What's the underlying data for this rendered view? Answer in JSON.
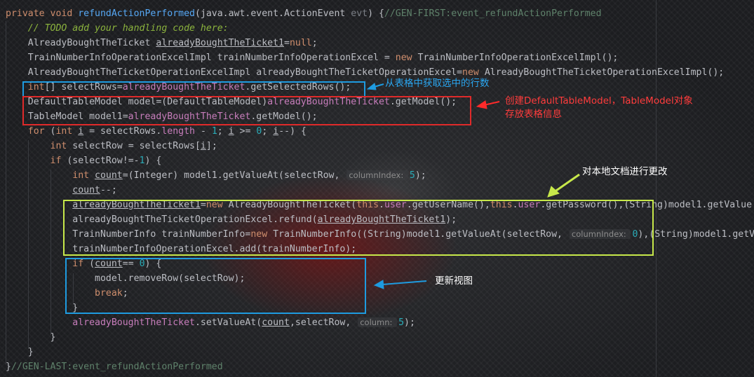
{
  "code_lines": [
    [
      {
        "t": "private void ",
        "c": "kw"
      },
      {
        "t": "refundActionPerformed",
        "c": "fn"
      },
      {
        "t": "(java.awt.event.ActionEvent "
      },
      {
        "t": "evt",
        "c": "cmt"
      },
      {
        "t": ") {"
      },
      {
        "t": "//GEN-FIRST:event_refundActionPerformed",
        "c": "gen"
      }
    ],
    [
      {
        "t": "    "
      },
      {
        "t": "// TODO add your handling code here:",
        "c": "cmt-todo"
      }
    ],
    [
      {
        "t": "    AlreadyBoughtTheTicket "
      },
      {
        "t": "alreadyBoughtTheTicket1",
        "c": "var-u"
      },
      {
        "t": "="
      },
      {
        "t": "null",
        "c": "kw"
      },
      {
        "t": ";"
      }
    ],
    [
      {
        "t": "    TrainNumberInfoOperationExcelImpl trainNumberInfoOperationExcel = "
      },
      {
        "t": "new ",
        "c": "kw"
      },
      {
        "t": "TrainNumberInfoOperationExcelImpl();"
      }
    ],
    [
      {
        "t": "    AlreadyBoughtTheTicketOperationExcelImpl alreadyBoughtTheTicketOperationExcel="
      },
      {
        "t": "new ",
        "c": "kw"
      },
      {
        "t": "AlreadyBoughtTheTicketOperationExcelImpl();"
      }
    ],
    [
      {
        "t": "    "
      },
      {
        "t": "int",
        "c": "kw"
      },
      {
        "t": "[] selectRows="
      },
      {
        "t": "alreadyBoughtTheTicket",
        "c": "fld"
      },
      {
        "t": ".getSelectedRows();"
      }
    ],
    [
      {
        "t": "    DefaultTableModel model=(DefaultTableModel)"
      },
      {
        "t": "alreadyBoughtTheTicket",
        "c": "fld"
      },
      {
        "t": ".getModel();"
      }
    ],
    [
      {
        "t": "    TableModel model1="
      },
      {
        "t": "alreadyBoughtTheTicket",
        "c": "fld"
      },
      {
        "t": ".getModel();"
      }
    ],
    [
      {
        "t": "    "
      },
      {
        "t": "for ",
        "c": "kw"
      },
      {
        "t": "("
      },
      {
        "t": "int ",
        "c": "kw"
      },
      {
        "t": "i",
        "c": "var-u"
      },
      {
        "t": " = selectRows."
      },
      {
        "t": "length",
        "c": "fld"
      },
      {
        "t": " - "
      },
      {
        "t": "1",
        "c": "num"
      },
      {
        "t": "; "
      },
      {
        "t": "i",
        "c": "var-u"
      },
      {
        "t": " >= "
      },
      {
        "t": "0",
        "c": "num"
      },
      {
        "t": "; "
      },
      {
        "t": "i",
        "c": "var-u"
      },
      {
        "t": "--) {"
      }
    ],
    [
      {
        "t": "        "
      },
      {
        "t": "int ",
        "c": "kw"
      },
      {
        "t": "selectRow = selectRows["
      },
      {
        "t": "i",
        "c": "var-u"
      },
      {
        "t": "];"
      }
    ],
    [
      {
        "t": "        "
      },
      {
        "t": "if ",
        "c": "kw"
      },
      {
        "t": "(selectRow!=-"
      },
      {
        "t": "1",
        "c": "num"
      },
      {
        "t": ") {"
      }
    ],
    [
      {
        "t": "            "
      },
      {
        "t": "int ",
        "c": "kw"
      },
      {
        "t": "count",
        "c": "var-u"
      },
      {
        "t": "=(Integer) model1.getValueAt(selectRow, "
      },
      {
        "t": "columnIndex: ",
        "c": "hint"
      },
      {
        "t": "5",
        "c": "num"
      },
      {
        "t": ");"
      }
    ],
    [
      {
        "t": "            "
      },
      {
        "t": "count",
        "c": "var-u"
      },
      {
        "t": "--;"
      }
    ],
    [
      {
        "t": "            "
      },
      {
        "t": "alreadyBoughtTheTicket1",
        "c": "var-u"
      },
      {
        "t": "="
      },
      {
        "t": "new ",
        "c": "kw"
      },
      {
        "t": "AlreadyBoughtTheTicket("
      },
      {
        "t": "this",
        "c": "kw"
      },
      {
        "t": "."
      },
      {
        "t": "user",
        "c": "fld"
      },
      {
        "t": ".getUserName(),"
      },
      {
        "t": "this",
        "c": "kw"
      },
      {
        "t": "."
      },
      {
        "t": "user",
        "c": "fld"
      },
      {
        "t": ".getPassword(),(String)model1.getValue"
      }
    ],
    [
      {
        "t": "            alreadyBoughtTheTicketOperationExcel.refund("
      },
      {
        "t": "alreadyBoughtTheTicket1",
        "c": "var-u"
      },
      {
        "t": ");"
      }
    ],
    [
      {
        "t": "            TrainNumberInfo trainNumberInfo="
      },
      {
        "t": "new ",
        "c": "kw"
      },
      {
        "t": "TrainNumberInfo((String)model1.getValueAt(selectRow, "
      },
      {
        "t": "columnIndex: ",
        "c": "hint"
      },
      {
        "t": "0",
        "c": "num"
      },
      {
        "t": "),(String)model1.getV"
      }
    ],
    [
      {
        "t": "            trainNumberInfoOperationExcel.add(trainNumberInfo);"
      }
    ],
    [
      {
        "t": "            "
      },
      {
        "t": "if ",
        "c": "kw"
      },
      {
        "t": "("
      },
      {
        "t": "count",
        "c": "var-u"
      },
      {
        "t": "== "
      },
      {
        "t": "0",
        "c": "num"
      },
      {
        "t": ") {"
      }
    ],
    [
      {
        "t": "                model.removeRow(selectRow);"
      }
    ],
    [
      {
        "t": "                "
      },
      {
        "t": "break",
        "c": "kw"
      },
      {
        "t": ";"
      }
    ],
    [
      {
        "t": "            }"
      }
    ],
    [
      {
        "t": "            "
      },
      {
        "t": "alreadyBoughtTheTicket",
        "c": "fld"
      },
      {
        "t": ".setValueAt("
      },
      {
        "t": "count",
        "c": "var-u"
      },
      {
        "t": ",selectRow, "
      },
      {
        "t": "column: ",
        "c": "hint"
      },
      {
        "t": "5",
        "c": "num"
      },
      {
        "t": ");"
      }
    ],
    [
      {
        "t": "        }"
      }
    ],
    [
      {
        "t": "    }"
      }
    ],
    [
      {
        "t": "}"
      },
      {
        "t": "//GEN-LAST:event_refundActionPerformed",
        "c": "gen"
      }
    ]
  ],
  "annotations": {
    "get_selected_rows": "从表格中获取选中的行数",
    "create_model": "创建DefaultTableModel，TableModel对象\n存放表格信息",
    "modify_local_doc": "对本地文档进行更改",
    "refresh_view": "更新视图"
  },
  "colors": {
    "blue_box": "#1e9be0",
    "red_box": "#e02a2a",
    "green_box": "#c7e84a",
    "arrow_yellow": "#c7e84a"
  }
}
